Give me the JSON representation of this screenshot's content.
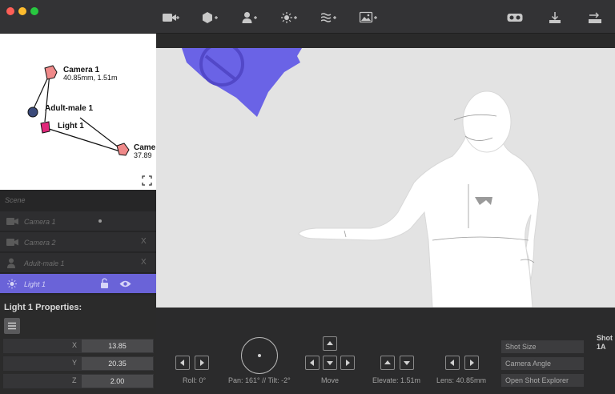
{
  "window": {
    "traffic_lights": {
      "close": "#fe5f57",
      "minimize": "#febc2e",
      "maximize": "#28c840"
    }
  },
  "toolbar": {
    "left_icons": [
      "add-camera-icon",
      "add-object-icon",
      "add-character-icon",
      "add-light-icon",
      "add-volume-icon",
      "add-image-icon"
    ],
    "right_icons": [
      "vr-headset-icon",
      "export-icon",
      "swap-icon"
    ]
  },
  "diagram": {
    "camera1_label": "Camera 1",
    "camera1_sub": "40.85mm, 1.51m",
    "character_label": "Adult-male 1",
    "light_label": "Light 1",
    "camera2_label": "Came",
    "camera2_sub": "37.89",
    "colors": {
      "camera": "#f08a8a",
      "light": "#e0287a",
      "character": "#3b4a7a"
    }
  },
  "scene": {
    "title": "Scene",
    "items": [
      {
        "label": "Camera 1",
        "icon": "camera-icon",
        "trailing": "dot"
      },
      {
        "label": "Camera 2",
        "icon": "camera-icon",
        "trailing": "X"
      },
      {
        "label": "Adult-male 1",
        "icon": "person-icon",
        "trailing": "X"
      },
      {
        "label": "Light 1",
        "icon": "light-icon",
        "trailing": "lock-eye",
        "active": true
      }
    ],
    "active_color": "#6a63d8"
  },
  "properties": {
    "title": "Light 1 Properties:",
    "fields": [
      {
        "key": "X",
        "value": "13.85"
      },
      {
        "key": "Y",
        "value": "20.35"
      },
      {
        "key": "Z",
        "value": "2.00"
      }
    ]
  },
  "controls": {
    "roll_label": "Roll: 0°",
    "pan_tilt_label": "Pan: 161° // Tilt: -2°",
    "move_label": "Move",
    "elevate_label": "Elevate: 1.51m",
    "lens_label": "Lens: 40.85mm",
    "shot_size": "Shot Size",
    "camera_angle": "Camera Angle",
    "open_shot_explorer": "Open Shot Explorer",
    "shot_label_line1": "Shot",
    "shot_label_line2": "1A"
  },
  "viewport": {
    "light_color": "#6a63e6",
    "background": "#e3e3e3"
  }
}
